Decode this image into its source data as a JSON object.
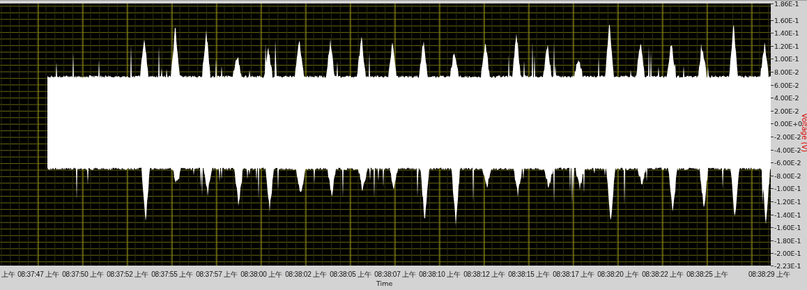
{
  "chart": {
    "y_axis": {
      "title": "Voltage (V)",
      "tick_labels": [
        "1.86E-1",
        "1.60E-1",
        "1.40E-1",
        "1.20E-1",
        "1.00E-1",
        "8.00E-2",
        "6.00E-2",
        "4.00E-2",
        "2.00E-2",
        "0.00E+0",
        "-2.00E-2",
        "-4.00E-2",
        "-6.00E-2",
        "-8.00E-2",
        "-1.00E-1",
        "-1.20E-1",
        "-1.40E-1",
        "-1.60E-1",
        "-1.80E-1",
        "-2.00E-1",
        "-2.23E-1"
      ]
    },
    "x_axis": {
      "title": "Time",
      "tick_labels": [
        "上午",
        "08:37:47 上午",
        "08:37:50 上午",
        "08:37:52 上午",
        "08:37:55 上午",
        "08:37:57 上午",
        "08:38:00 上午",
        "08:38:02 上午",
        "08:38:05 上午",
        "08:38:07 上午",
        "08:38:10 上午",
        "08:38:12 上午",
        "08:38:15 上午",
        "08:38:17 上午",
        "08:38:20 上午",
        "08:38:22 上午",
        "08:38:25 上午",
        "08:38:29 上午"
      ]
    }
  }
}
